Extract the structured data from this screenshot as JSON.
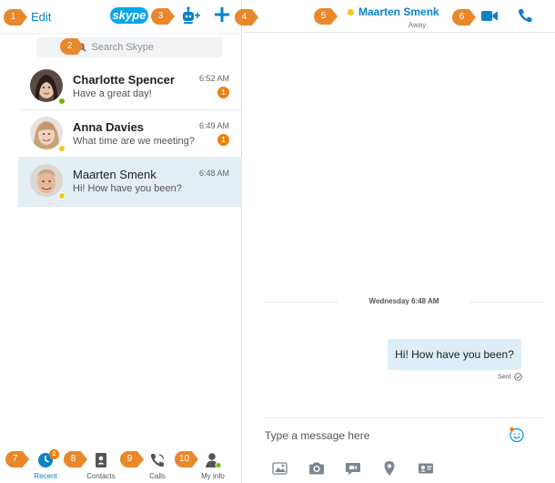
{
  "header": {
    "edit_label": "Edit",
    "logo_text": "skype",
    "add_bot_icon": "bot-add-icon",
    "new_conversation_icon": "plus-icon"
  },
  "search": {
    "placeholder": "Search Skype"
  },
  "conversations": [
    {
      "name": "Charlotte Spencer",
      "message": "Have a great day!",
      "time": "6:52 AM",
      "unread": "1",
      "presence": "online",
      "selected": false
    },
    {
      "name": "Anna Davies",
      "message": "What time are we meeting?",
      "time": "6:49 AM",
      "unread": "1",
      "presence": "away",
      "selected": false
    },
    {
      "name": "Maarten Smenk",
      "message": "Hi!  How have you been?",
      "time": "6:48 AM",
      "unread": "",
      "presence": "away",
      "selected": true
    }
  ],
  "nav": {
    "recent": {
      "label": "Recent",
      "badge": "2"
    },
    "contacts": {
      "label": "Contacts"
    },
    "calls": {
      "label": "Calls"
    },
    "my_info": {
      "label": "My info"
    }
  },
  "chat": {
    "contact_name": "Maarten Smenk",
    "contact_status": "Away",
    "date_separator": "Wednesday 6:48 AM",
    "message": "Hi!  How have you been?",
    "sent_label": "Sent",
    "compose_placeholder": "Type a message here"
  },
  "callouts": [
    "1",
    "2",
    "3",
    "4",
    "5",
    "6",
    "7",
    "8",
    "9",
    "10"
  ],
  "colors": {
    "accent": "#0a82c8",
    "callout": "#e8882a",
    "unread_badge": "#f07f0e",
    "online": "#6bb700",
    "away": "#f5c518",
    "selected_row": "#e4eef5",
    "sent_bubble": "#ddeef8"
  }
}
